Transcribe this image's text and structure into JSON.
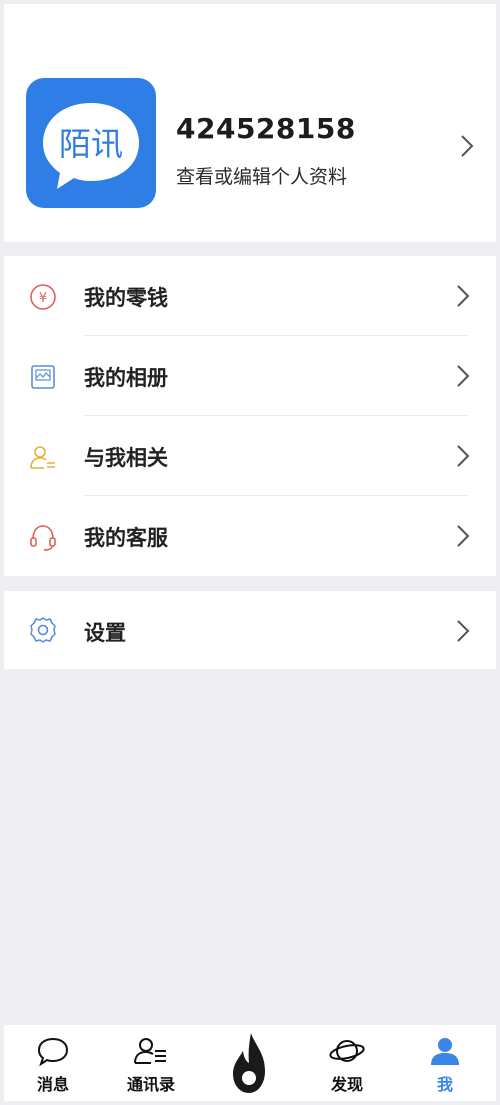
{
  "profile": {
    "logo_text": "陌讯",
    "user_id": "424528158",
    "subtitle": "查看或编辑个人资料"
  },
  "menu": {
    "group1": [
      {
        "label": "我的零钱",
        "icon": "yuan-coin-icon"
      },
      {
        "label": "我的相册",
        "icon": "photo-album-icon"
      },
      {
        "label": "与我相关",
        "icon": "person-list-icon"
      },
      {
        "label": "我的客服",
        "icon": "headset-icon"
      }
    ],
    "group2": [
      {
        "label": "设置",
        "icon": "gear-icon"
      }
    ]
  },
  "tabbar": {
    "tabs": [
      {
        "label": "消息",
        "icon": "chat-bubble-icon",
        "active": false
      },
      {
        "label": "通讯录",
        "icon": "contacts-icon",
        "active": false
      },
      {
        "label": "",
        "icon": "flame-icon",
        "active": false
      },
      {
        "label": "发现",
        "icon": "planet-icon",
        "active": false
      },
      {
        "label": "我",
        "icon": "user-icon",
        "active": true
      }
    ]
  },
  "colors": {
    "brand_blue": "#2f7ee6",
    "active_tab": "#3a86e8",
    "background": "#eeeef3",
    "coin_red": "#e0605a",
    "album_blue": "#5a8fd9",
    "person_yellow": "#e6b23a",
    "headset_red": "#e0605a",
    "gear_blue": "#4f8de0"
  }
}
